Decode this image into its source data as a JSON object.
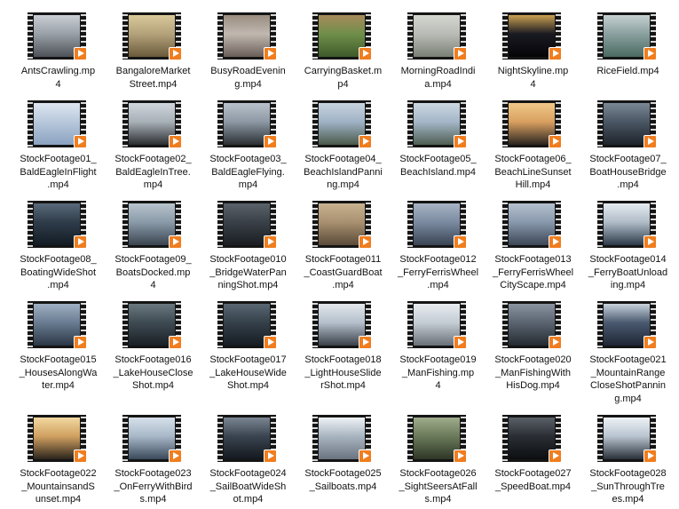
{
  "colors": {
    "play_badge": "#f07d1e",
    "film_strip": "#151515",
    "background": "#ffffff"
  },
  "icons": {
    "play": "play-icon",
    "film": "film-strip-icon"
  },
  "files": [
    {
      "name": "AntsCrawling.mp4",
      "lines": [
        "AntsCrawling.mp",
        "4"
      ],
      "palette": [
        "#9aa0a8",
        "#4e5258",
        "#c9ced4"
      ]
    },
    {
      "name": "BangaloreMarketStreet.mp4",
      "lines": [
        "BangaloreMarket",
        "Street.mp4"
      ],
      "palette": [
        "#b3a27a",
        "#6b5a3a",
        "#d9c89a"
      ]
    },
    {
      "name": "BusyRoadEvening.mp4",
      "lines": [
        "BusyRoadEvenin",
        "g.mp4"
      ],
      "palette": [
        "#c0b8b0",
        "#6a5f58",
        "#9a8d80"
      ]
    },
    {
      "name": "CarryingBasket.mp4",
      "lines": [
        "CarryingBasket.m",
        "p4"
      ],
      "palette": [
        "#6f8f4a",
        "#3e5a2a",
        "#a88a5a"
      ]
    },
    {
      "name": "MorningRoadIndia.mp4",
      "lines": [
        "MorningRoadIndi",
        "a.mp4"
      ],
      "palette": [
        "#b9bcb6",
        "#7a8076",
        "#d4d6d0"
      ]
    },
    {
      "name": "NightSkyline.mp4",
      "lines": [
        "NightSkyline.mp",
        "4"
      ],
      "palette": [
        "#1a1a22",
        "#050508",
        "#caa050"
      ]
    },
    {
      "name": "RiceField.mp4",
      "lines": [
        "RiceField.mp4"
      ],
      "palette": [
        "#8aa0a0",
        "#4a6a60",
        "#c6d0d0"
      ]
    },
    {
      "name": "StockFootage01_BaldEagleInFlight.mp4",
      "lines": [
        "StockFootage01_",
        "BaldEagleInFlight",
        ".mp4"
      ],
      "palette": [
        "#b8c8dc",
        "#8aa2c0",
        "#dde6f0"
      ]
    },
    {
      "name": "StockFootage02_BaldEagleInTree.mp4",
      "lines": [
        "StockFootage02_",
        "BaldEagleInTree.",
        "mp4"
      ],
      "palette": [
        "#a8b0b8",
        "#2a2e30",
        "#d0d6dc"
      ]
    },
    {
      "name": "StockFootage03_BaldEagleFlying.mp4",
      "lines": [
        "StockFootage03_",
        "BaldEagleFlying.",
        "mp4"
      ],
      "palette": [
        "#8c98a4",
        "#2c3034",
        "#b8c2cc"
      ]
    },
    {
      "name": "StockFootage04_BeachIslandPanning.mp4",
      "lines": [
        "StockFootage04_",
        "BeachIslandPanni",
        "ng.mp4"
      ],
      "palette": [
        "#9fb2c6",
        "#4a5a4a",
        "#c8d4de"
      ]
    },
    {
      "name": "StockFootage05_BeachIsland.mp4",
      "lines": [
        "StockFootage05_",
        "BeachIsland.mp4"
      ],
      "palette": [
        "#a4b6c8",
        "#4e5e52",
        "#cdd8e2"
      ]
    },
    {
      "name": "StockFootage06_BeachLineSunsetHill.mp4",
      "lines": [
        "StockFootage06_",
        "BeachLineSunset",
        "Hill.mp4"
      ],
      "palette": [
        "#d8a060",
        "#2a2420",
        "#f0c888"
      ]
    },
    {
      "name": "StockFootage07_BoatHouseBridge.mp4",
      "lines": [
        "StockFootage07_",
        "BoatHouseBridge",
        ".mp4"
      ],
      "palette": [
        "#4a5664",
        "#1e242a",
        "#7a8896"
      ]
    },
    {
      "name": "StockFootage08_BoatingWideShot.mp4",
      "lines": [
        "StockFootage08_",
        "BoatingWideShot",
        ".mp4"
      ],
      "palette": [
        "#2e3c4a",
        "#141c24",
        "#5a6a7a"
      ]
    },
    {
      "name": "StockFootage09_BoatsDocked.mp4",
      "lines": [
        "StockFootage09_",
        "BoatsDocked.mp",
        "4"
      ],
      "palette": [
        "#8a9aa8",
        "#3a4450",
        "#b8c4ce"
      ]
    },
    {
      "name": "StockFootage010_BridgeWaterPanningShot.mp4",
      "lines": [
        "StockFootage010",
        "_BridgeWaterPan",
        "ningShot.mp4"
      ],
      "palette": [
        "#3a4048",
        "#1a1e22",
        "#5a626a"
      ]
    },
    {
      "name": "StockFootage011_CoastGuardBoat.mp4",
      "lines": [
        "StockFootage011",
        "_CoastGuardBoat",
        ".mp4"
      ],
      "palette": [
        "#a89070",
        "#5a4a38",
        "#c8b290"
      ]
    },
    {
      "name": "StockFootage012_FerryFerrisWheel.mp4",
      "lines": [
        "StockFootage012",
        "_FerryFerrisWheel",
        ".mp4"
      ],
      "palette": [
        "#7a8aa0",
        "#3a4454",
        "#a8b4c4"
      ]
    },
    {
      "name": "StockFootage013_FerryFerrisWheelCityScape.mp4",
      "lines": [
        "StockFootage013",
        "_FerryFerrisWheel",
        "CityScape.mp4"
      ],
      "palette": [
        "#8898ac",
        "#3c4656",
        "#b4c0ce"
      ]
    },
    {
      "name": "StockFootage014_FerryBoatUnloading.mp4",
      "lines": [
        "StockFootage014",
        "_FerryBoatUnload",
        "ing.mp4"
      ],
      "palette": [
        "#b0bcc8",
        "#2c3a48",
        "#e4eaf0"
      ]
    },
    {
      "name": "StockFootage015_HousesAlongWater.mp4",
      "lines": [
        "StockFootage015",
        "_HousesAlongWa",
        "ter.mp4"
      ],
      "palette": [
        "#6a7c92",
        "#2a3644",
        "#a0b0c2"
      ]
    },
    {
      "name": "StockFootage016_LakeHouseCloseShot.mp4",
      "lines": [
        "StockFootage016",
        "_LakeHouseClose",
        "Shot.mp4"
      ],
      "palette": [
        "#3e4a52",
        "#1a2026",
        "#6a7880"
      ]
    },
    {
      "name": "StockFootage017_LakeHouseWideShot.mp4",
      "lines": [
        "StockFootage017",
        "_LakeHouseWide",
        "Shot.mp4"
      ],
      "palette": [
        "#34404a",
        "#161c22",
        "#5a6874"
      ]
    },
    {
      "name": "StockFootage018_LightHouseSliderShot.mp4",
      "lines": [
        "StockFootage018",
        "_LightHouseSlide",
        "rShot.mp4"
      ],
      "palette": [
        "#b4c0cc",
        "#3a4048",
        "#e2e6ea"
      ]
    },
    {
      "name": "StockFootage019_ManFishing.mp4",
      "lines": [
        "StockFootage019",
        "_ManFishing.mp",
        "4"
      ],
      "palette": [
        "#c4ccd4",
        "#6a7078",
        "#e8ecf0"
      ]
    },
    {
      "name": "StockFootage020_ManFishingWithHisDog.mp4",
      "lines": [
        "StockFootage020",
        "_ManFishingWith",
        "HisDog.mp4"
      ],
      "palette": [
        "#5a6470",
        "#242a30",
        "#8a94a0"
      ]
    },
    {
      "name": "StockFootage021_MountainRangeCloseShotPanning.mp4",
      "lines": [
        "StockFootage021",
        "_MountainRange",
        "CloseShotPannin",
        "g.mp4"
      ],
      "palette": [
        "#4a5a70",
        "#1e2634",
        "#c8d2dc"
      ]
    },
    {
      "name": "StockFootage022_MountainsandSunset.mp4",
      "lines": [
        "StockFootage022",
        "_MountainsandS",
        "unset.mp4"
      ],
      "palette": [
        "#d0a060",
        "#2a241c",
        "#f2d8a0"
      ]
    },
    {
      "name": "StockFootage023_OnFerryWithBirds.mp4",
      "lines": [
        "StockFootage023",
        "_OnFerryWithBird",
        "s.mp4"
      ],
      "palette": [
        "#a8b8c8",
        "#3a4a5a",
        "#d6e0ea"
      ]
    },
    {
      "name": "StockFootage024_SailBoatWideShot.mp4",
      "lines": [
        "StockFootage024",
        "_SailBoatWideSh",
        "ot.mp4"
      ],
      "palette": [
        "#3a4450",
        "#14181e",
        "#7a8692"
      ]
    },
    {
      "name": "StockFootage025_Sailboats.mp4",
      "lines": [
        "StockFootage025",
        "_Sailboats.mp4"
      ],
      "palette": [
        "#a8b4c0",
        "#6a7480",
        "#eef2f6"
      ]
    },
    {
      "name": "StockFootage026_SightSeersAtFalls.mp4",
      "lines": [
        "StockFootage026",
        "_SightSeersAtFall",
        "s.mp4"
      ],
      "palette": [
        "#6a7a5a",
        "#2e3626",
        "#a0ac8c"
      ]
    },
    {
      "name": "StockFootage027_SpeedBoat.mp4",
      "lines": [
        "StockFootage027",
        "_SpeedBoat.mp4"
      ],
      "palette": [
        "#2a2e34",
        "#0c0e10",
        "#5a6068"
      ]
    },
    {
      "name": "StockFootage028_SunThroughTrees.mp4",
      "lines": [
        "StockFootage028",
        "_SunThroughTre",
        "es.mp4"
      ],
      "palette": [
        "#b8c4d0",
        "#2a3038",
        "#eef2f6"
      ]
    }
  ]
}
